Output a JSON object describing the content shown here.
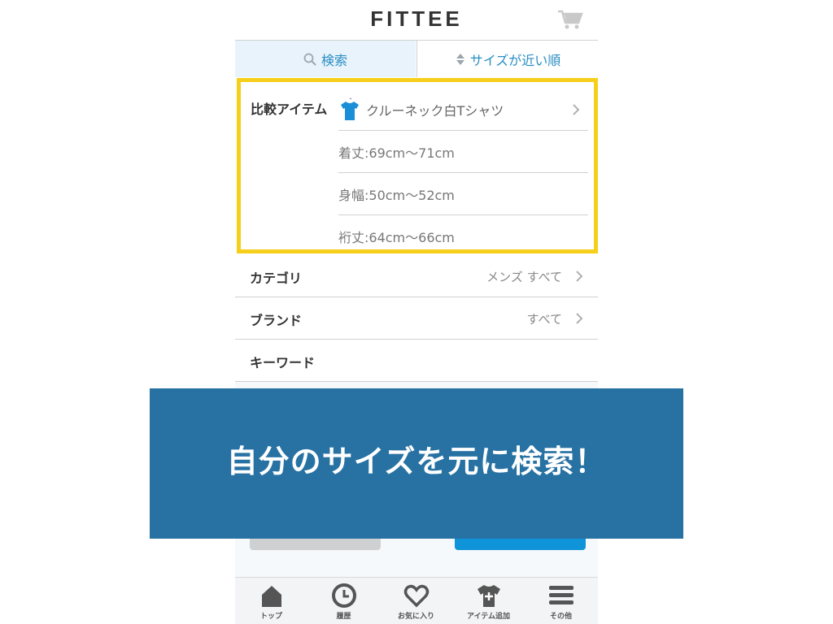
{
  "app": {
    "logo": "FITTEE"
  },
  "segment": {
    "search_label": "検索",
    "sort_label": "サイズが近い順"
  },
  "compare": {
    "label": "比較アイテム",
    "item_name": "クルーネック白Tシャツ",
    "dims": [
      "着丈:69cm〜71cm",
      "身幅:50cm〜52cm",
      "裄丈:64cm〜66cm"
    ]
  },
  "filters": [
    {
      "label": "カテゴリ",
      "value": "メンズ すべて"
    },
    {
      "label": "ブランド",
      "value": "すべて"
    },
    {
      "label": "キーワード",
      "value": ""
    }
  ],
  "banner": {
    "text": "自分のサイズを元に検索！"
  },
  "tabs": [
    "トップ",
    "履歴",
    "お気に入り",
    "アイテム追加",
    "その他"
  ],
  "colors": {
    "accent": "#2a8fc4",
    "highlight": "#f6cf1c",
    "banner": "#2872a3",
    "primary_button": "#0f94d9"
  }
}
